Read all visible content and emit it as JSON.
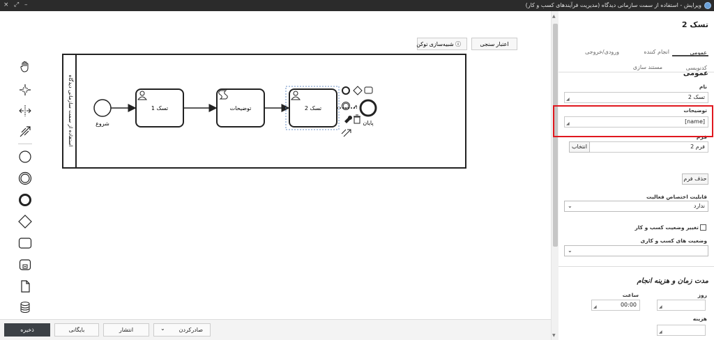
{
  "titlebar": {
    "title": "ویرایش - استفاده از سمت سازمانی دیدگاه  (مدیریت فرآیندهای کسب و کار)",
    "close": "×",
    "maximize": "⤢",
    "minimize": "–"
  },
  "top_buttons": {
    "validate": "اعتبار سنجی",
    "token_sim": "شبیه‌سازی توکن",
    "token_sim_icon": "ⓘ"
  },
  "diagram": {
    "pool_label": "استفاده از سمت سازمانی دیدگاه",
    "start_label": "شروع",
    "task1": "تسک 1",
    "script_task": "توضیحات",
    "task2": "تسک 2",
    "end_label": "پایان"
  },
  "panel": {
    "title": "تسک 2",
    "tabs": {
      "general": "عمومی",
      "executor": "انجام کننده",
      "io": "ورودی/خروجی",
      "coding": "کدنویسی",
      "documentation": "مستند سازی"
    },
    "section_general": "عمومی",
    "name_label": "نام",
    "name_value": "تسک 2",
    "desc_label": "توضیحات",
    "desc_value": "[name]",
    "form_label": "فرم",
    "form_value": "فرم 2",
    "select_button": "انتخاب",
    "delete_form": "حذف فرم",
    "assign_label": "قابلیت اختصاص فعالیت",
    "assign_value": "ندارد",
    "change_status_label": "تغییر وضعیت کسب و کار",
    "status_label": "وضعیت های کسب و کاری",
    "status_value": "",
    "section_time": "مدت زمان و هزینه انجام",
    "day_label": "روز",
    "hour_label": "ساعت",
    "hour_value": "00:00",
    "cost_label": "هزینه"
  },
  "bottom": {
    "save": "ذخیره",
    "archive": "بایگانی",
    "publish": "انتشار",
    "export": "صادرکردن",
    "export_chevron": "⌄"
  },
  "colors": {
    "highlight": "#e0171e",
    "titlebar": "#2b2b2b",
    "primary_button": "#3c4146"
  },
  "icons": [
    "hand-tool-icon",
    "lasso-tool-icon",
    "space-tool-icon",
    "connect-tool-icon",
    "start-event-icon",
    "intermediate-event-icon",
    "end-event-icon",
    "gateway-icon",
    "task-icon",
    "subprocess-icon",
    "data-object-icon",
    "data-store-icon",
    "user-icon",
    "script-icon",
    "wrench-icon",
    "trash-icon",
    "connect-icon"
  ]
}
